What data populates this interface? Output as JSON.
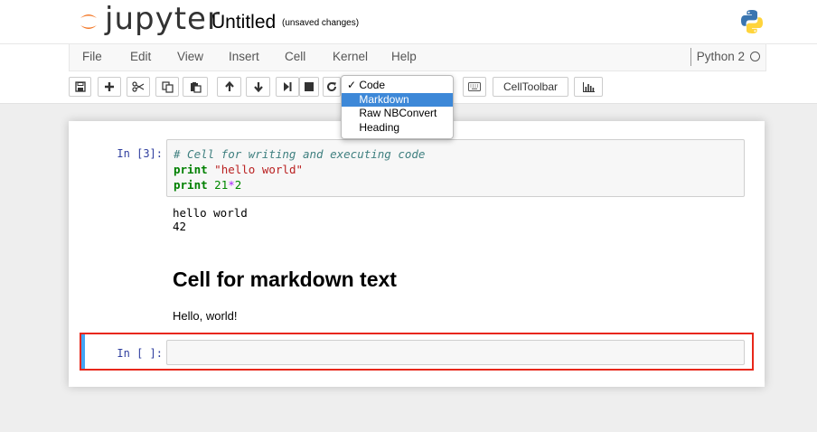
{
  "header": {
    "logo_text": "jupyter",
    "title": "Untitled",
    "save_status": "(unsaved changes)",
    "python_logo_icon": "python-logo-icon"
  },
  "menubar": {
    "items": [
      "File",
      "Edit",
      "View",
      "Insert",
      "Cell",
      "Kernel",
      "Help"
    ],
    "kernel_name": "Python 2"
  },
  "toolbar": {
    "buttons": [
      "save-icon",
      "plus-icon",
      "scissors-icon",
      "copy-icon",
      "paste-icon",
      "arrow-up-icon",
      "arrow-down-icon",
      "step-forward-icon",
      "stop-icon",
      "restart-icon"
    ],
    "keyboard_icon": "keyboard-icon",
    "celltoolbar_label": "CellToolbar",
    "chart_icon": "bar-chart-icon"
  },
  "celltype_dropdown": {
    "options": [
      "Code",
      "Markdown",
      "Raw NBConvert",
      "Heading"
    ],
    "checked": "Code",
    "highlighted": "Markdown",
    "checkmark": "✓"
  },
  "cells": {
    "code_prompt": "In [3]:",
    "code_lines": {
      "line1": "# Cell for writing and executing code",
      "line2_kw": "print",
      "line2_str": "\"hello world\"",
      "line3_kw": "print",
      "line3_num1": "21",
      "line3_op": "*",
      "line3_num2": "2"
    },
    "output_lines": [
      "hello world",
      "42"
    ],
    "markdown_heading": "Cell for markdown text",
    "markdown_paragraph": "Hello, world!",
    "empty_prompt": "In [ ]:"
  },
  "colors": {
    "selected_border": "#e8271a",
    "edit_mode_bar": "#42a5f5",
    "dropdown_highlight": "#3d88d8"
  }
}
